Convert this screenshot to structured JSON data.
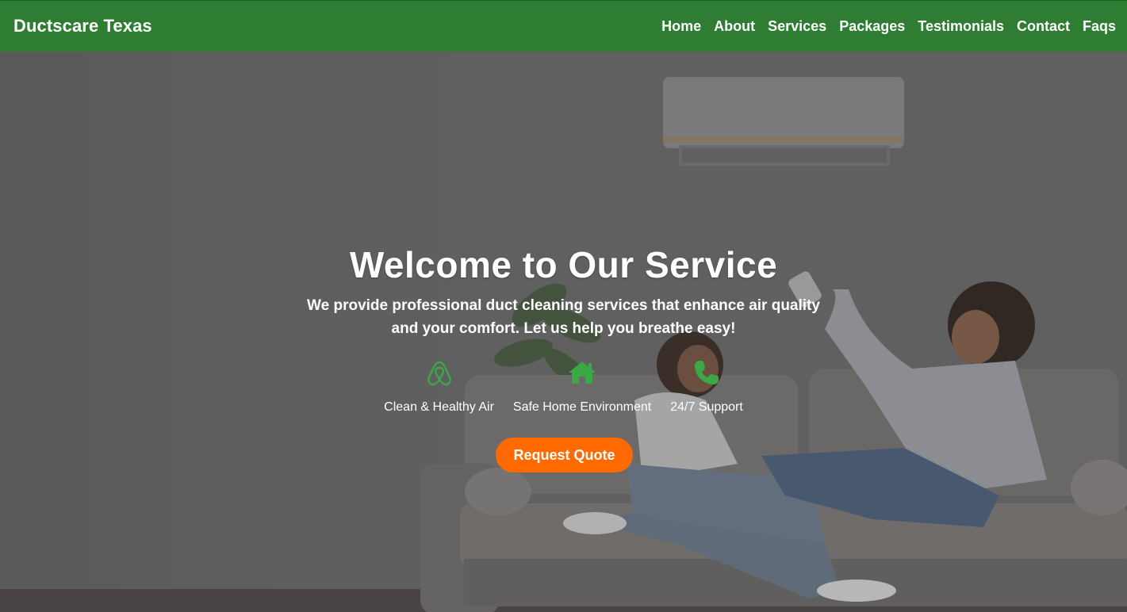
{
  "navbar": {
    "brand": "Ductscare Texas",
    "links": [
      "Home",
      "About",
      "Services",
      "Packages",
      "Testimonials",
      "Contact",
      "Faqs"
    ]
  },
  "hero": {
    "title": "Welcome to Our Service",
    "subtitle": "We provide professional duct cleaning services that enhance air quality and your comfort. Let us help you breathe easy!",
    "features": [
      {
        "icon": "airbnb-icon",
        "label": "Clean & Healthy Air"
      },
      {
        "icon": "home-icon",
        "label": "Safe Home Environment"
      },
      {
        "icon": "phone-icon",
        "label": "24/7 Support"
      }
    ],
    "cta": "Request Quote"
  },
  "colors": {
    "nav_bg": "#2e7d32",
    "icon_green": "#3aa845",
    "cta_orange": "#ff6a00"
  }
}
